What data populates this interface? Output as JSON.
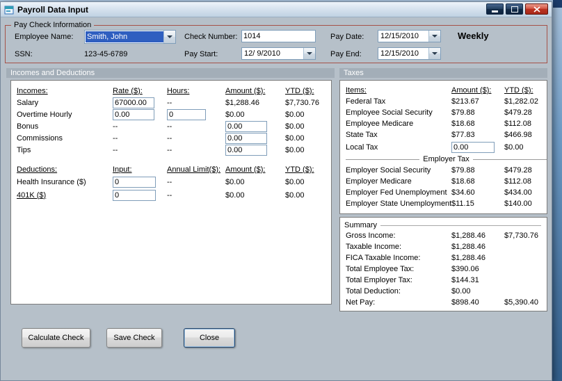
{
  "colors": {
    "selection_blue": "#2f5fc0",
    "group_border_red": "#a55248",
    "close_button_red": "#bb3322",
    "section_bar_gray": "#a3aeb8"
  },
  "window": {
    "title": "Payroll Data Input"
  },
  "paycheck": {
    "legend": "Pay Check Information",
    "employee_name": {
      "label": "Employee Name:",
      "value": "Smith, John"
    },
    "ssn": {
      "label": "SSN:",
      "value": "123-45-6789"
    },
    "check_number": {
      "label": "Check Number:",
      "value": "1014"
    },
    "pay_start": {
      "label": "Pay Start:",
      "value": "12/ 9/2010"
    },
    "pay_date": {
      "label": "Pay Date:",
      "value": "12/15/2010"
    },
    "pay_end": {
      "label": "Pay End:",
      "value": "12/15/2010"
    },
    "frequency": "Weekly"
  },
  "sections": {
    "incomes_and_deductions": "Incomes and Deductions",
    "taxes": "Taxes"
  },
  "incomes": {
    "headers": [
      "Incomes:",
      "Rate ($):",
      "Hours:",
      "Amount ($):",
      "YTD ($):"
    ],
    "rows": [
      {
        "label": "Salary",
        "rate": "67000.00",
        "hours": "--",
        "amount": "$1,288.46",
        "ytd": "$7,730.76"
      },
      {
        "label": "Overtime Hourly",
        "rate": "0.00",
        "hours": "0",
        "amount": "$0.00",
        "ytd": "$0.00"
      },
      {
        "label": "Bonus",
        "rate": "--",
        "hours": "--",
        "amount": "0.00",
        "ytd": "$0.00"
      },
      {
        "label": "Commissions",
        "rate": "--",
        "hours": "--",
        "amount": "0.00",
        "ytd": "$0.00"
      },
      {
        "label": "Tips",
        "rate": "--",
        "hours": "--",
        "amount": "0.00",
        "ytd": "$0.00"
      }
    ]
  },
  "deductions": {
    "headers": [
      "Deductions:",
      "Input:",
      "Annual Limit($):",
      "Amount ($):",
      "YTD ($):"
    ],
    "rows": [
      {
        "label": "Health Insurance  ($)",
        "input": "0",
        "limit": "--",
        "amount": "$0.00",
        "ytd": "$0.00"
      },
      {
        "label": "401K  ($)",
        "input": "0",
        "limit": "--",
        "amount": "$0.00",
        "ytd": "$0.00"
      }
    ]
  },
  "taxes": {
    "headers": [
      "Items:",
      "Amount ($):",
      "YTD ($):"
    ],
    "employee_rows": [
      {
        "label": "Federal Tax",
        "amount": "$213.67",
        "ytd": "$1,282.02"
      },
      {
        "label": "Employee Social Security",
        "amount": "$79.88",
        "ytd": "$479.28"
      },
      {
        "label": "Employee Medicare",
        "amount": "$18.68",
        "ytd": "$112.08"
      },
      {
        "label": "State Tax",
        "amount": "$77.83",
        "ytd": "$466.98"
      },
      {
        "label": "Local Tax",
        "amount": "0.00",
        "ytd": "$0.00"
      }
    ],
    "divider": "Employer Tax",
    "employer_rows": [
      {
        "label": "Employer Social Security",
        "amount": "$79.88",
        "ytd": "$479.28"
      },
      {
        "label": "Employer Medicare",
        "amount": "$18.68",
        "ytd": "$112.08"
      },
      {
        "label": "Employer Fed Unemployment",
        "amount": "$34.60",
        "ytd": "$434.00"
      },
      {
        "label": "Employer State Unemployment",
        "amount": "$11.15",
        "ytd": "$140.00"
      }
    ]
  },
  "summary": {
    "title": "Summary",
    "rows": [
      {
        "label": "Gross Income:",
        "amount": "$1,288.46",
        "ytd": "$7,730.76"
      },
      {
        "label": "Taxable Income:",
        "amount": "$1,288.46",
        "ytd": ""
      },
      {
        "label": "FICA Taxable Income:",
        "amount": "$1,288.46",
        "ytd": ""
      },
      {
        "label": "Total Employee Tax:",
        "amount": "$390.06",
        "ytd": ""
      },
      {
        "label": "Total Employer Tax:",
        "amount": "$144.31",
        "ytd": ""
      },
      {
        "label": "Total Deduction:",
        "amount": "$0.00",
        "ytd": ""
      },
      {
        "label": "Net Pay:",
        "amount": "$898.40",
        "ytd": "$5,390.40"
      }
    ]
  },
  "footer": {
    "calculate": "Calculate Check",
    "save": "Save Check",
    "close": "Close"
  }
}
